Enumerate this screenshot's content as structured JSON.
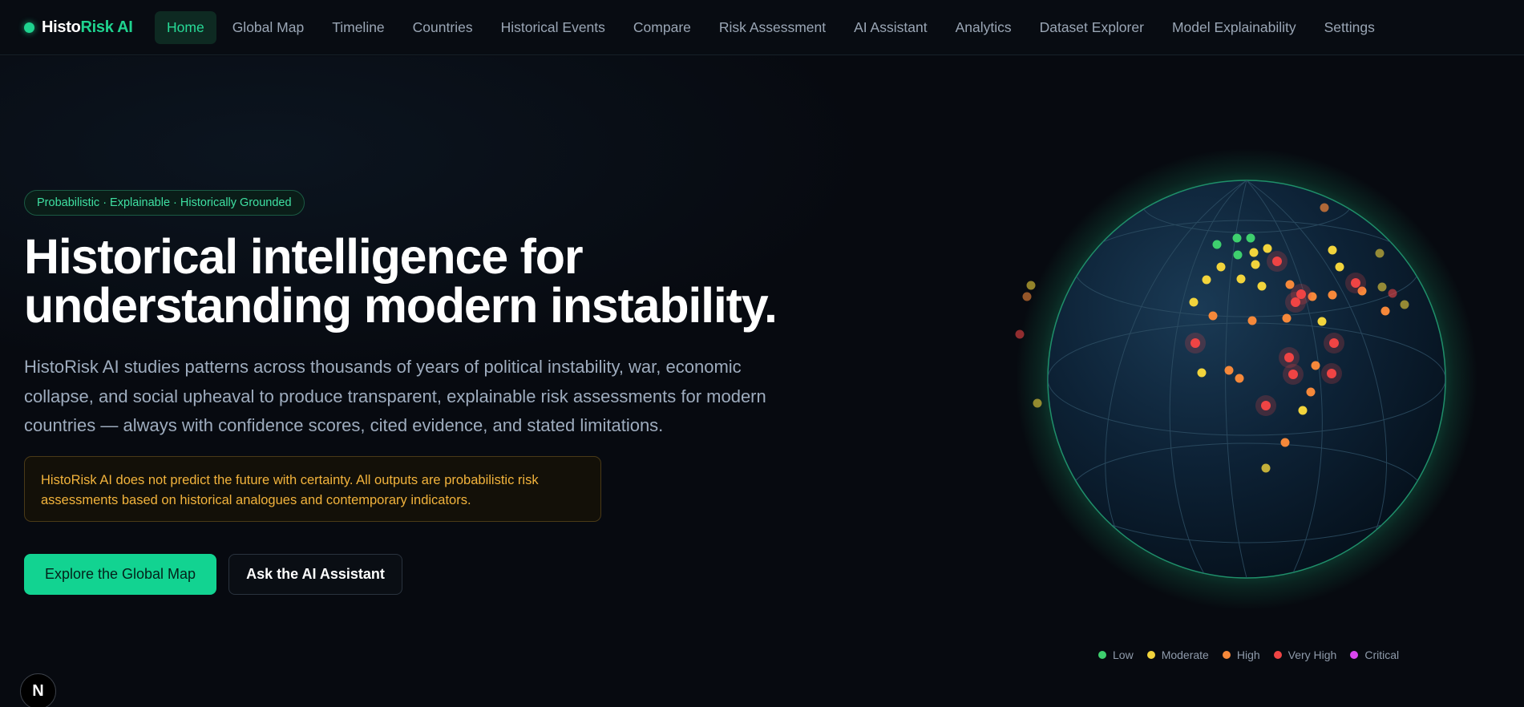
{
  "brand": {
    "name_part1": "Histo",
    "name_part2": "Risk AI",
    "logo_icon": "status-dot-icon"
  },
  "nav": [
    {
      "label": "Home",
      "active": true
    },
    {
      "label": "Global Map"
    },
    {
      "label": "Timeline"
    },
    {
      "label": "Countries"
    },
    {
      "label": "Historical Events"
    },
    {
      "label": "Compare"
    },
    {
      "label": "Risk Assessment"
    },
    {
      "label": "AI Assistant"
    },
    {
      "label": "Analytics"
    },
    {
      "label": "Dataset Explorer"
    },
    {
      "label": "Model Explainability"
    },
    {
      "label": "Settings"
    }
  ],
  "hero": {
    "tagline": "Probabilistic · Explainable · Historically Grounded",
    "headline_line1": "Historical intelligence for",
    "headline_line2": "understanding modern instability.",
    "subtext": "HistoRisk AI studies patterns across thousands of years of political instability, war, economic collapse, and social upheaval to produce transparent, explainable risk assessments for modern countries — always with confidence scores, cited evidence, and stated limitations.",
    "disclaimer": "HistoRisk AI does not predict the future with certainty. All outputs are probabilistic risk assessments based on historical analogues and contemporary indicators.",
    "primary_button": "Explore the Global Map",
    "secondary_button": "Ask the AI Assistant"
  },
  "legend": [
    {
      "label": "Low",
      "color": "#3ecf6e"
    },
    {
      "label": "Moderate",
      "color": "#f2d43c"
    },
    {
      "label": "High",
      "color": "#f5883a"
    },
    {
      "label": "Very High",
      "color": "#ef4444"
    },
    {
      "label": "Critical",
      "color": "#d946ef"
    }
  ],
  "corner_badge": {
    "label": "N"
  },
  "colors": {
    "accent": "#1fd38f",
    "background": "#070a10",
    "warning": "#f2b33c"
  }
}
